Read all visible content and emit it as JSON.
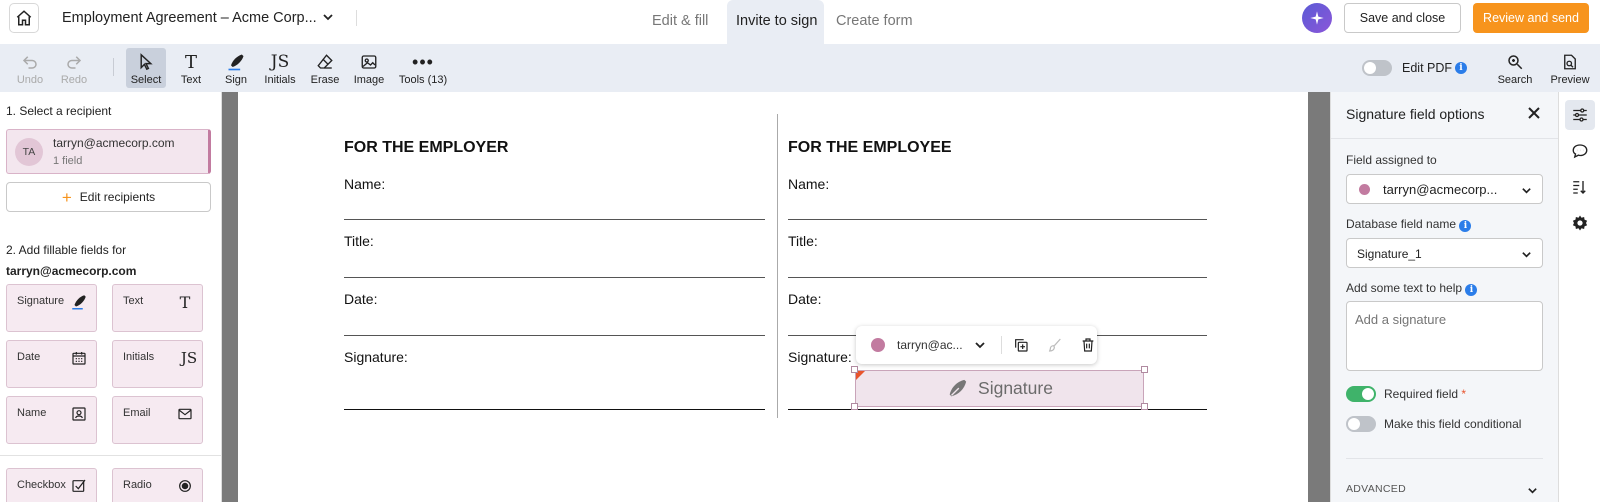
{
  "header": {
    "doc_title": "Employment Agreement – Acme Corp...",
    "tabs": [
      "Edit & fill",
      "Invite to sign",
      "Create form"
    ],
    "active_tab": "Invite to sign",
    "save_close": "Save and close",
    "review_send": "Review and send",
    "accent_color": "#f7941d"
  },
  "toolbar": {
    "tools": [
      {
        "label": "Undo",
        "icon": "undo-icon"
      },
      {
        "label": "Redo",
        "icon": "redo-icon"
      },
      {
        "label": "Select",
        "icon": "cursor-icon"
      },
      {
        "label": "Text",
        "icon": "text-icon"
      },
      {
        "label": "Sign",
        "icon": "pen-icon"
      },
      {
        "label": "Initials",
        "icon": "initials-icon"
      },
      {
        "label": "Erase",
        "icon": "eraser-icon"
      },
      {
        "label": "Image",
        "icon": "image-icon"
      },
      {
        "label": "Tools (13)",
        "icon": "more-icon"
      }
    ],
    "edit_pdf": "Edit PDF",
    "search": "Search",
    "preview": "Preview"
  },
  "left_panel": {
    "step1": "1. Select a recipient",
    "recipient": {
      "initials": "TA",
      "email": "tarryn@acmecorp.com",
      "count": "1 field"
    },
    "edit_recipients": "Edit recipients",
    "step2": "2. Add fillable fields for",
    "step2_email": "tarryn@acmecorp.com",
    "fields": [
      {
        "label": "Signature",
        "icon": "signature-pen-icon"
      },
      {
        "label": "Text",
        "icon": "text-icon"
      },
      {
        "label": "Date",
        "icon": "calendar-icon"
      },
      {
        "label": "Initials",
        "icon": "initials-icon"
      },
      {
        "label": "Name",
        "icon": "contact-card-icon"
      },
      {
        "label": "Email",
        "icon": "envelope-icon"
      },
      {
        "label": "Checkbox",
        "icon": "checkbox-icon"
      },
      {
        "label": "Radio",
        "icon": "radio-icon"
      }
    ]
  },
  "document": {
    "employer_heading": "FOR THE EMPLOYER",
    "employee_heading": "FOR THE EMPLOYEE",
    "labels": {
      "name": "Name:",
      "title": "Title:",
      "date": "Date:",
      "signature": "Signature:"
    },
    "context_email": "tarryn@ac...",
    "field_text": "Signature",
    "recipient_color": "#c27ba0"
  },
  "right_panel": {
    "title": "Signature field options",
    "assigned_label": "Field assigned to",
    "assigned_value": "tarryn@acmecorp...",
    "db_label": "Database field name",
    "db_value": "Signature_1",
    "help_label": "Add some text to help",
    "help_placeholder": "Add a signature",
    "required_label": "Required field",
    "required_star": "*",
    "conditional_label": "Make this field conditional",
    "advanced": "ADVANCED"
  }
}
